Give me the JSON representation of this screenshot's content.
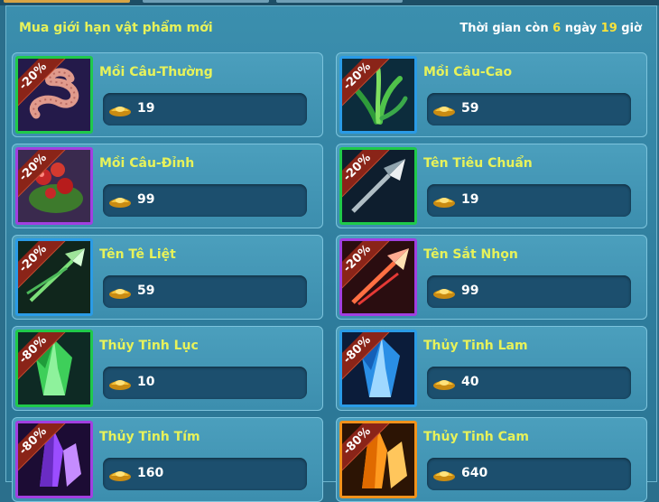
{
  "header": {
    "title": "Mua giới hạn vật phẩm mới",
    "time_prefix": "Thời gian còn",
    "days": "6",
    "days_unit": "ngày",
    "hours": "19",
    "hours_unit": "giờ"
  },
  "items": [
    {
      "name": "Mồi Câu-Thường",
      "discount": "-20%",
      "price": "19",
      "icon": "worm-bait-icon",
      "rarity": "green"
    },
    {
      "name": "Mồi Câu-Cao",
      "discount": "-20%",
      "price": "59",
      "icon": "seaweed-bait-icon",
      "rarity": "blue"
    },
    {
      "name": "Mồi Câu-Đỉnh",
      "discount": "-20%",
      "price": "99",
      "icon": "berry-bait-icon",
      "rarity": "purple"
    },
    {
      "name": "Tên Tiêu Chuẩn",
      "discount": "-20%",
      "price": "19",
      "icon": "standard-arrow-icon",
      "rarity": "green"
    },
    {
      "name": "Tên Tê Liệt",
      "discount": "-20%",
      "price": "59",
      "icon": "paralysis-arrow-icon",
      "rarity": "blue"
    },
    {
      "name": "Tên Sắt Nhọn",
      "discount": "-20%",
      "price": "99",
      "icon": "iron-arrow-icon",
      "rarity": "purple"
    },
    {
      "name": "Thủy Tinh Lục",
      "discount": "-80%",
      "price": "10",
      "icon": "green-crystal-icon",
      "rarity": "green"
    },
    {
      "name": "Thủy Tinh Lam",
      "discount": "-80%",
      "price": "40",
      "icon": "blue-crystal-icon",
      "rarity": "blue"
    },
    {
      "name": "Thủy Tinh Tím",
      "discount": "-80%",
      "price": "160",
      "icon": "purple-crystal-icon",
      "rarity": "purple"
    },
    {
      "name": "Thủy Tinh Cam",
      "discount": "-80%",
      "price": "640",
      "icon": "orange-crystal-icon",
      "rarity": "orange"
    }
  ],
  "currency_icon": "gold-ingot-icon",
  "colors": {
    "accent_text": "#e7f25a",
    "ribbon": "#8a2418",
    "panel": "#3b8fae",
    "price_box": "#1c4f6e"
  }
}
